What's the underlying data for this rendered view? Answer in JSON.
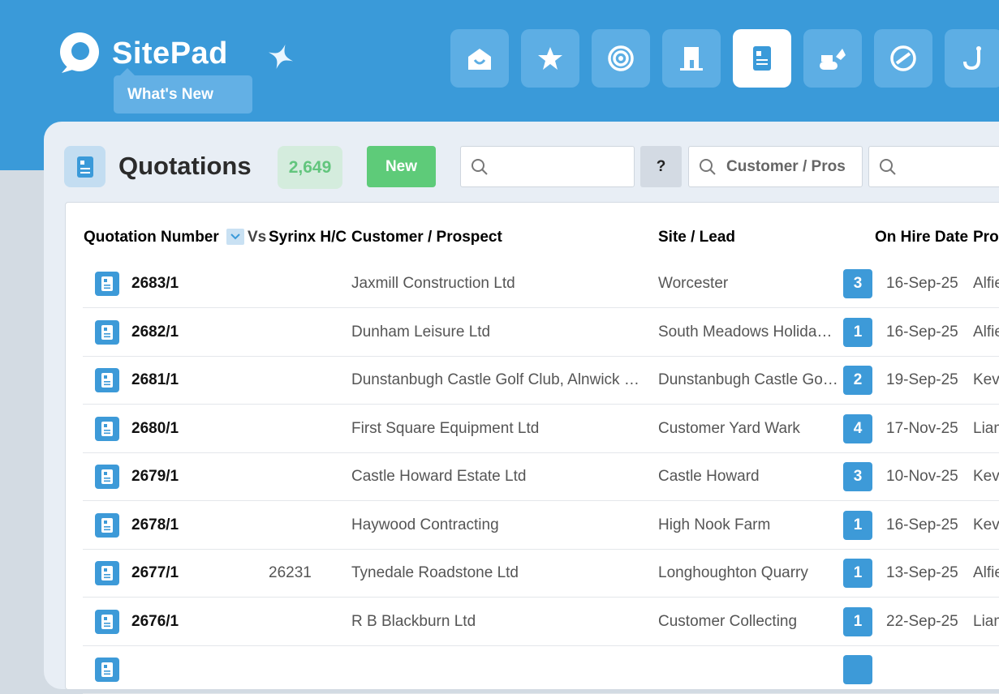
{
  "app": {
    "name": "SitePad",
    "whats_new": "What's New"
  },
  "nav": {
    "items": [
      {
        "icon": "home-icon",
        "active": false
      },
      {
        "icon": "star-icon",
        "active": false
      },
      {
        "icon": "target-icon",
        "active": false
      },
      {
        "icon": "building-icon",
        "active": false
      },
      {
        "icon": "quotation-icon",
        "active": true
      },
      {
        "icon": "machinery-icon",
        "active": false
      },
      {
        "icon": "link-icon",
        "active": false
      },
      {
        "icon": "hook-icon",
        "active": false
      }
    ]
  },
  "page": {
    "title": "Quotations",
    "count": "2,649",
    "new_label": "New",
    "help_label": "?"
  },
  "filters": {
    "customer_placeholder": "Customer / Pros"
  },
  "table": {
    "headers": {
      "quotation_number": "Quotation Number",
      "vs": "Vs",
      "syrinx_hc": "Syrinx H/C",
      "customer": "Customer / Prospect",
      "site": "Site / Lead",
      "on_hire_date": "On Hire Date",
      "pro": "Pro"
    },
    "rows": [
      {
        "number": "2683/1",
        "hc": "",
        "customer": "Jaxmill Construction Ltd",
        "site": "Worcester",
        "count": "3",
        "date": "16-Sep-25",
        "person": "Alfie"
      },
      {
        "number": "2682/1",
        "hc": "",
        "customer": "Dunham Leisure Ltd",
        "site": "South Meadows Holiday Park",
        "count": "1",
        "date": "16-Sep-25",
        "person": "Alfie"
      },
      {
        "number": "2681/1",
        "hc": "",
        "customer": "Dunstanbugh Castle Golf Club, Alnwick Road",
        "site": "Dunstanbugh Castle Golf Club",
        "count": "2",
        "date": "19-Sep-25",
        "person": "Kevin"
      },
      {
        "number": "2680/1",
        "hc": "",
        "customer": "First Square Equipment Ltd",
        "site": "Customer Yard Wark",
        "count": "4",
        "date": "17-Nov-25",
        "person": "Liam"
      },
      {
        "number": "2679/1",
        "hc": "",
        "customer": "Castle Howard Estate Ltd",
        "site": "Castle Howard",
        "count": "3",
        "date": "10-Nov-25",
        "person": "Kevin"
      },
      {
        "number": "2678/1",
        "hc": "",
        "customer": "Haywood Contracting",
        "site": "High Nook Farm",
        "count": "1",
        "date": "16-Sep-25",
        "person": "Kevin"
      },
      {
        "number": "2677/1",
        "hc": "26231",
        "customer": "Tynedale Roadstone Ltd",
        "site": "Longhoughton Quarry",
        "count": "1",
        "date": "13-Sep-25",
        "person": "Alfie"
      },
      {
        "number": "2676/1",
        "hc": "",
        "customer": "R B Blackburn Ltd",
        "site": "Customer Collecting",
        "count": "1",
        "date": "22-Sep-25",
        "person": "Liam"
      },
      {
        "number": "",
        "hc": "",
        "customer": "",
        "site": "",
        "count": "",
        "date": "",
        "person": ""
      }
    ]
  },
  "colors": {
    "brand": "#3a9ad9",
    "accent_green": "#5ecb79",
    "badge_blue": "#3d9ad8"
  }
}
